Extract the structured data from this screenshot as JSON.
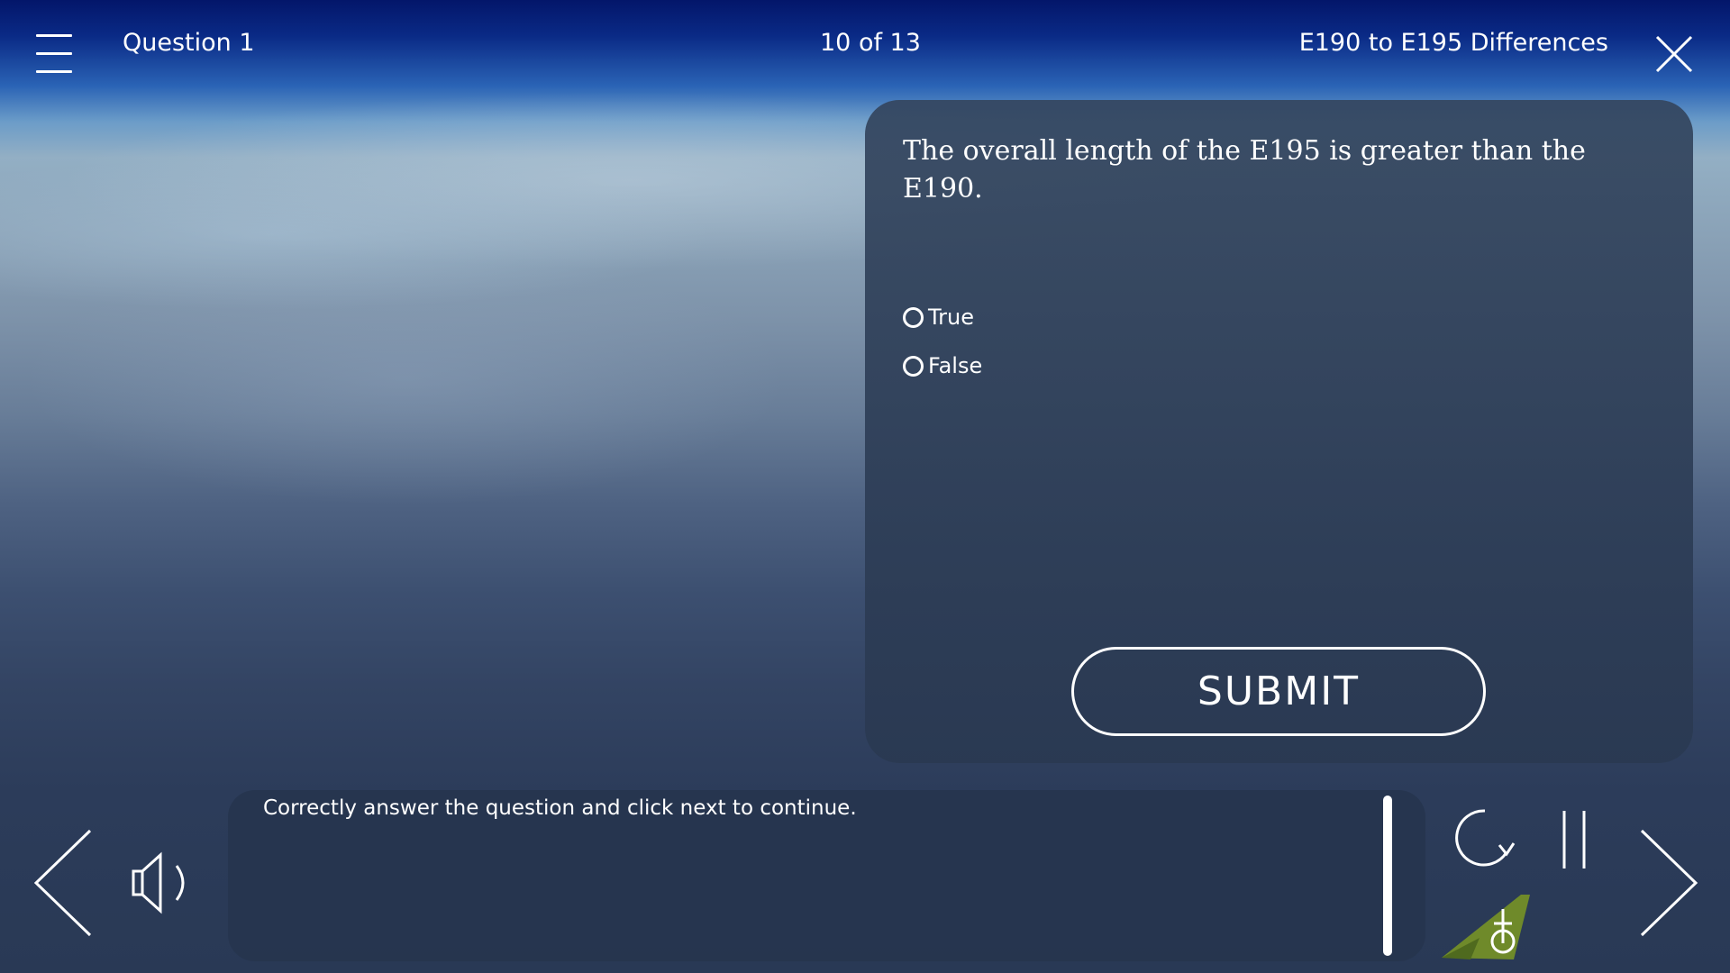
{
  "header": {
    "question_label": "Question 1",
    "progress": "10 of 13",
    "course_title": "E190 to E195 Differences",
    "menu_icon": "hamburger-menu-icon",
    "close_icon": "close-icon"
  },
  "question": {
    "text": "The overall length of the E195 is greater than the E190.",
    "options": [
      {
        "label": "True",
        "selected": false
      },
      {
        "label": "False",
        "selected": false
      }
    ],
    "submit_label": "SUBMIT"
  },
  "transcript": {
    "text": "Correctly answer the question and click next to continue."
  },
  "controls": {
    "back_icon": "chevron-left-icon",
    "audio_icon": "speaker-icon",
    "replay_icon": "replay-icon",
    "pause_icon": "pause-icon",
    "next_icon": "chevron-right-icon"
  },
  "colors": {
    "panel_background": "#2f4060",
    "text": "#ffffff",
    "logo_tail": "#6f8a2a"
  }
}
